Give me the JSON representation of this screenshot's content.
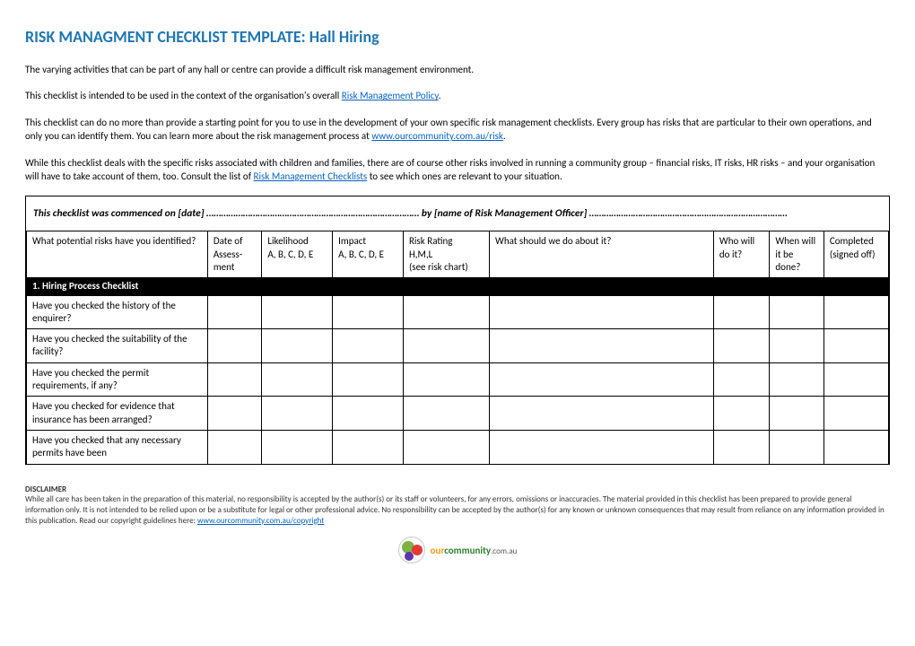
{
  "title": "RISK MANAGMENT CHECKLIST TEMPLATE: Hall Hiring",
  "intro": {
    "p1": "The varying activities that can be part of any hall or centre can provide a difficult risk management environment.",
    "p2a": "This checklist is intended to be used in the context of the organisation's overall ",
    "p2link": "Risk Management Policy",
    "p2b": ".",
    "p3a": "This checklist can do no more than provide a starting point for you to use in the development of your own specific risk management checklists. Every group has risks that are particular to their own operations, and only you can identify them. You can learn more about the risk management process at ",
    "p3link": "www.ourcommunity.com.au/risk",
    "p3b": ".",
    "p4a": "While this checklist deals with the specific risks associated with children and families, there are of course other risks involved in running a community group – financial risks, IT risks, HR risks – and your organisation will have to take account of them, too. Consult the list of ",
    "p4link": "Risk Management Checklists",
    "p4b": " to see which ones are relevant to your situation."
  },
  "meta_row": "This checklist was commenced on [date] …………………………………………………………………………… by [name of Risk Management Officer] ………………………………………………………………………",
  "headers": {
    "risk": "What potential risks have you identified?",
    "date": "Date of Assess-ment",
    "like": "Likelihood\nA, B, C, D, E",
    "impact": "Impact\nA, B, C, D, E",
    "rating": "Risk Rating\nH,M,L\n(see risk chart)",
    "action": "What should we do about it?",
    "who": "Who will do it?",
    "when": "When will it be done?",
    "comp": "Completed (signed off)"
  },
  "section1_title": "1.  Hiring Process Checklist",
  "rows": [
    "Have you checked the history of the enquirer?",
    "Have you checked the suitability of the facility?",
    "Have you checked the permit requirements, if any?",
    "Have you checked for evidence that insurance has been arranged?",
    "Have you checked that any necessary permits have been"
  ],
  "disclaimer": {
    "heading": "DISCLAIMER",
    "body_a": "While all care has been taken in the preparation of this material, no responsibility is accepted by the author(s) or its staff or volunteers, for any errors, omissions or inaccuracies. The material provided in this checklist has been prepared to provide general information only. It is not intended to be relied upon or be a substitute for legal or other professional advice. No responsibility can be accepted by the author(s) for any known or unknown consequences that may result from reliance on any information provided in this publication. Read our copyright guidelines here: ",
    "link": "www.ourcommunity.com.au/copyright"
  },
  "logo": {
    "our": "our",
    "community": "community",
    "domain": ".com.au"
  }
}
